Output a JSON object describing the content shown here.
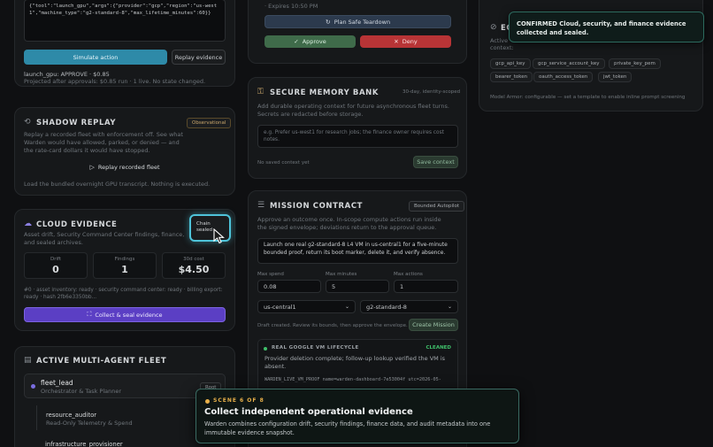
{
  "left": {
    "code_preview": "{\"tool\":\"launch_gpu\",\"args\":{\"provider\":\"gcp\",\"region\":\"us-west1\",\"machine_type\":\"g2-standard-8\",\"max_lifetime_minutes\":60}}",
    "simulate_label": "Simulate action",
    "replay_evidence_label": "Replay evidence",
    "result_line": "launch_gpu: APPROVE · $0.85",
    "projection_line": "Projected after approvals: $0.85 run · 1 live. No state changed.",
    "shadow": {
      "title": "SHADOW REPLAY",
      "badge": "Observational",
      "desc": "Replay a recorded fleet with enforcement off. See what Warden would have allowed, parked, or denied — and the rate-card dollars it would have stopped.",
      "button": "Replay recorded fleet",
      "status": "Load the bundled overnight GPU transcript. Nothing is executed."
    },
    "cloud": {
      "title": "CLOUD EVIDENCE",
      "chain_label": "Chain sealed",
      "desc": "Asset drift, Security Command Center findings, finance, and sealed archives.",
      "stats": [
        {
          "label": "Drift",
          "value": "0"
        },
        {
          "label": "Findings",
          "value": "1"
        },
        {
          "label": "30d cost",
          "value": "$4.50"
        }
      ],
      "status": "#0 · asset inventory: ready · security command center: ready · billing export: ready · hash 2fb6e3350bb...",
      "button": "Collect & seal evidence"
    },
    "fleet": {
      "title": "ACTIVE MULTI-AGENT FLEET",
      "lead_name": "fleet_lead",
      "lead_role": "Orchestrator & Task Planner",
      "lead_badge": "Root",
      "auditor_name": "resource_auditor",
      "auditor_role": "Read-Only Telemetry & Spend",
      "auditor_badge": "Un",
      "provisioner_name": "infrastructure_provisioner"
    }
  },
  "middle": {
    "expires": "· Expires 10:50 PM",
    "plan_teardown": "Plan Safe Teardown",
    "approve": "Approve",
    "deny": "Deny",
    "memory": {
      "title": "SECURE MEMORY BANK",
      "badge": "30-day, identity-scoped",
      "desc": "Add durable operating context for future asynchronous fleet turns. Secrets are redacted before storage.",
      "placeholder": "e.g. Prefer us-west1 for research jobs; the finance owner requires cost notes.",
      "empty": "No saved context yet",
      "save": "Save context"
    },
    "mission": {
      "title": "MISSION CONTRACT",
      "badge": "Bounded Autopilot",
      "desc": "Approve an outcome once. In-scope compute actions run inside the signed envelope; deviations return to the approval queue.",
      "objective": "Launch one real g2-standard-8 L4 VM in us-central1 for a five-minute bounded proof, return its boot marker, delete it, and verify absence.",
      "max_spend_label": "Max spend",
      "max_spend": "0.08",
      "max_minutes_label": "Max minutes",
      "max_minutes": "5",
      "max_actions_label": "Max actions",
      "max_actions": "1",
      "region": "us-central1",
      "machine": "g2-standard-8",
      "draft_note": "Draft created. Review its bounds, then approve the envelope.",
      "create": "Create Mission",
      "lifecycle_title": "REAL GOOGLE VM LIFECYCLE",
      "lifecycle_status": "CLEANED",
      "lifecycle_desc": "Provider deletion complete; follow-up lookup verified the VM is absent.",
      "proof_line": "WARDEN_LIVE_VM_PROOF name=warden-dashboard-7e53004f utc=2026-05-"
    }
  },
  "right": {
    "title": "EG",
    "desc_prefix": "Active",
    "context_label": "context:",
    "tags": [
      "gcp_api_key",
      "gcp_service_account_key",
      "private_key_pem",
      "bearer_token",
      "oauth_access_token",
      "jwt_token"
    ],
    "note": "Model Armor: configurable — set a template to enable inline prompt screening"
  },
  "toast": {
    "text": "CONFIRMED Cloud, security, and finance evidence collected and sealed."
  },
  "scene": {
    "step": "SCENE 6 OF 8",
    "title": "Collect independent operational evidence",
    "desc": "Warden combines configuration drift, security findings, finance data, and audit metadata into one immutable evidence snapshot."
  },
  "colors": {
    "accent_teal": "#2e8aa8",
    "accent_purple": "#5b3fc4",
    "approve_green": "#3f6b4a",
    "deny_red": "#b83436",
    "cleaned_green": "#3fbf6a"
  }
}
